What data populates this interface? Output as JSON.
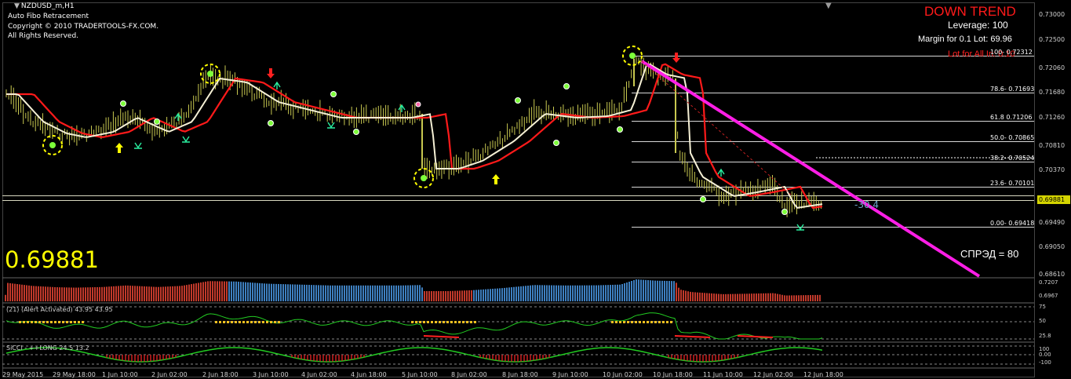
{
  "window": {
    "title": "NZDUSD_m,H1",
    "indicator_name": "Auto Fibo Retracement",
    "copyright": "Copyright © 2010 TRADERTOOLS-FX.COM.",
    "rights": "All Rights Reserved."
  },
  "big_price": "0.69881",
  "info": {
    "trend": "DOWN TREND",
    "leverage": "Leverage: 100",
    "margin": "Margin for 0.1 Lot: 69.96",
    "lot": "Lot for All In: 0.10",
    "spread": "СПРЭД = 80",
    "distance": "-30.4"
  },
  "fibo_levels": [
    {
      "label": "100- 0.72312",
      "price": 0.72312
    },
    {
      "label": "78.6- 0.71693",
      "price": 0.71693
    },
    {
      "label": "61.8 0.71206",
      "price": 0.71206
    },
    {
      "label": "50.0- 0.70865",
      "price": 0.70865
    },
    {
      "label": "38.2- 0.70524",
      "price": 0.70524
    },
    {
      "label": "23.6- 0.70101",
      "price": 0.70101
    },
    {
      "label": "0.00- 0.69418",
      "price": 0.69418
    }
  ],
  "y_ticks": [
    "0.73000",
    "0.72500",
    "0.72060",
    "0.71680",
    "0.71260",
    "0.70810",
    "0.70370",
    "0.69490",
    "0.69050",
    "0.68610"
  ],
  "current_price_tag": "0.69881",
  "x_ticks": [
    "29 May 2015",
    "29 May 18:00",
    "1 Jun 10:00",
    "2 Jun 02:00",
    "2 Jun 18:00",
    "3 Jun 10:00",
    "4 Jun 02:00",
    "4 Jun 18:00",
    "5 Jun 10:00",
    "8 Jun 02:00",
    "8 Jun 18:00",
    "9 Jun 10:00",
    "10 Jun 02:00",
    "10 Jun 18:00",
    "11 Jun 10:00",
    "12 Jun 02:00",
    "12 Jun 18:00"
  ],
  "subwindows": [
    {
      "title": "",
      "ticks": [
        "0.7207",
        "0.6967"
      ]
    },
    {
      "title": "(21) (Alert Activated) 43.95 43.95",
      "ticks": [
        "75",
        "50",
        "25.8"
      ]
    },
    {
      "title": "SiCCI - ++LONG 24.5 13.2",
      "ticks": [
        "100",
        "0.00",
        "-100"
      ]
    }
  ],
  "colors": {
    "candle": "#c8c850",
    "ma_slow": "#ff1a1a",
    "ma_fast": "#f5f0d5",
    "trendline": "#ff1ee6",
    "fibo": "#d8d8d8",
    "signal_circle": "#ffff00",
    "arrow_up": "#ffff00",
    "arrow_down": "#ff2020"
  },
  "icons": [
    "menu-arrow-icon",
    "signal-star-icon",
    "buy-arrow-icon",
    "sell-arrow-icon",
    "fractal-up-icon"
  ]
}
